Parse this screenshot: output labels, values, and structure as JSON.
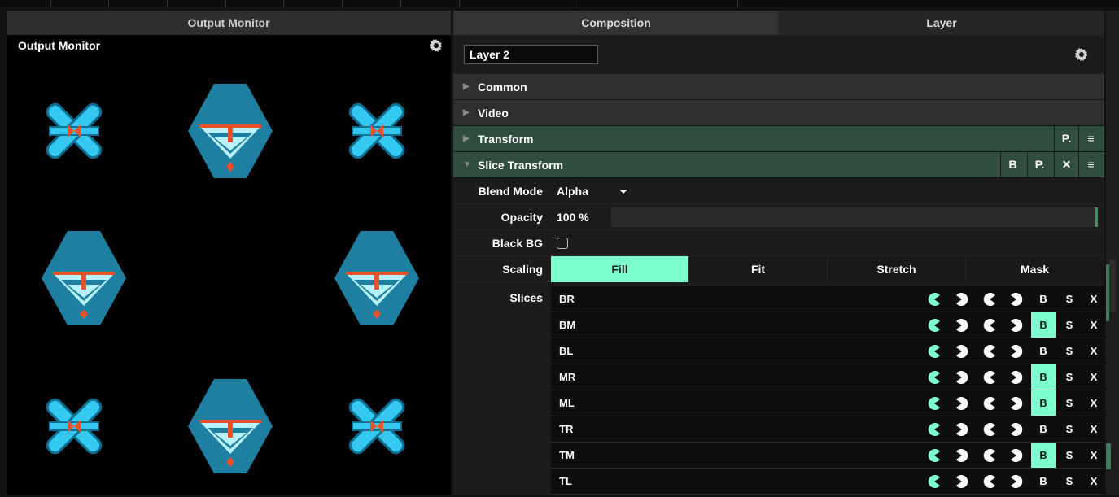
{
  "colors": {
    "accent": "#7effcf",
    "section_green": "#2f4e3e",
    "shape_cyan": "#35c8f0",
    "shape_teal": "#1f7fa0",
    "shape_orange": "#e8522a"
  },
  "output_monitor": {
    "tab_label": "Output Monitor",
    "title": "Output Monitor",
    "settings_icon": "gear-icon",
    "shapes": [
      "x-shape",
      "diamond-shape",
      "x-shape",
      "diamond-shape",
      "diamond-shape",
      "x-shape",
      "diamond-shape",
      "x-shape"
    ]
  },
  "tabs": [
    {
      "label": "Composition",
      "active": true
    },
    {
      "label": "Layer",
      "active": false
    }
  ],
  "layer": {
    "name": "Layer 2",
    "settings_icon": "gear-icon"
  },
  "sections": [
    {
      "title": "Common",
      "expanded": false,
      "buttons": []
    },
    {
      "title": "Video",
      "expanded": false,
      "buttons": []
    },
    {
      "title": "Transform",
      "expanded": false,
      "buttons": [
        "P.",
        "≡"
      ]
    },
    {
      "title": "Slice Transform",
      "expanded": true,
      "buttons": [
        "B",
        "P.",
        "✕",
        "≡"
      ]
    }
  ],
  "properties": {
    "blend_mode_label": "Blend Mode",
    "blend_mode_value": "Alpha",
    "opacity_label": "Opacity",
    "opacity_value": "100 %",
    "opacity_level": 1.0,
    "black_bg_label": "Black BG",
    "black_bg_checked": false,
    "scaling_label": "Scaling",
    "scaling_options": [
      "Fill",
      "Fit",
      "Stretch",
      "Mask"
    ],
    "scaling_selected": "Fill",
    "slices_label": "Slices"
  },
  "slices": [
    {
      "name": "BR",
      "b": false,
      "s": "S",
      "x": "X",
      "b_label": "B"
    },
    {
      "name": "BM",
      "b": true,
      "s": "S",
      "x": "X",
      "b_label": "B"
    },
    {
      "name": "BL",
      "b": false,
      "s": "S",
      "x": "X",
      "b_label": "B"
    },
    {
      "name": "MR",
      "b": true,
      "s": "S",
      "x": "X",
      "b_label": "B"
    },
    {
      "name": "ML",
      "b": true,
      "s": "S",
      "x": "X",
      "b_label": "B"
    },
    {
      "name": "TR",
      "b": false,
      "s": "S",
      "x": "X",
      "b_label": "B"
    },
    {
      "name": "TM",
      "b": true,
      "s": "S",
      "x": "X",
      "b_label": "B"
    },
    {
      "name": "TL",
      "b": false,
      "s": "S",
      "x": "X",
      "b_label": "B"
    }
  ],
  "slice_icons": [
    "pacman-left-active-icon",
    "pacman-right-icon",
    "pacman-left-icon",
    "pacman-right-icon"
  ]
}
